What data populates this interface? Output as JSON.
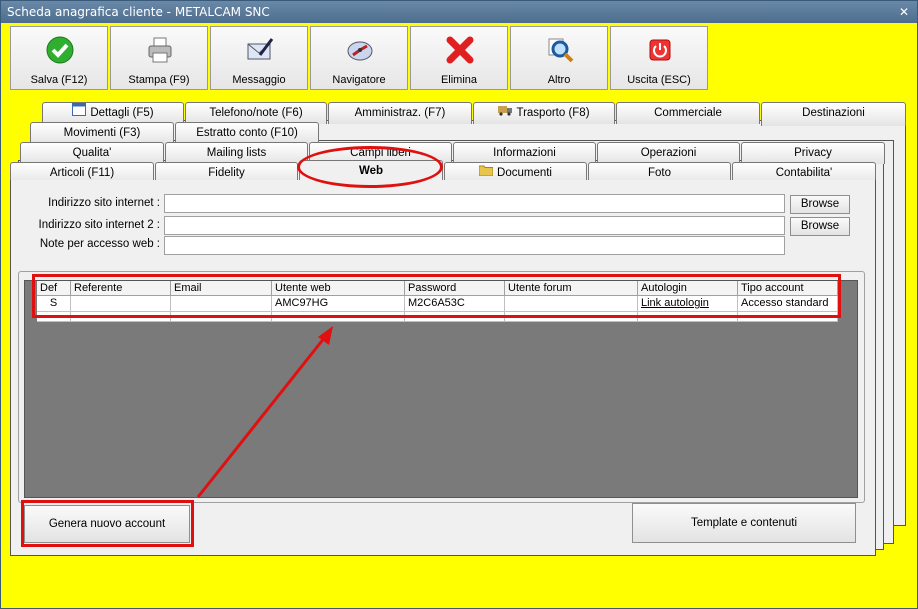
{
  "window": {
    "title": "Scheda anagrafica cliente - METALCAM SNC",
    "close_glyph": "✕"
  },
  "toolbar": [
    {
      "label": "Salva (F12)",
      "icon": "check-icon"
    },
    {
      "label": "Stampa (F9)",
      "icon": "printer-icon"
    },
    {
      "label": "Messaggio",
      "icon": "envelope-pen-icon"
    },
    {
      "label": "Navigatore",
      "icon": "compass-icon"
    },
    {
      "label": "Elimina",
      "icon": "delete-x-icon"
    },
    {
      "label": "Altro",
      "icon": "magnifier-icon"
    },
    {
      "label": "Uscita (ESC)",
      "icon": "power-icon"
    }
  ],
  "tabs": {
    "row1": [
      "Dettagli (F5)",
      "Telefono/note (F6)",
      "Amministraz. (F7)",
      "Trasporto (F8)",
      "Commerciale",
      "Destinazioni"
    ],
    "row2": [
      "Movimenti (F3)",
      "Estratto conto (F10)"
    ],
    "row3": [
      "Qualita'",
      "Mailing lists",
      "Campi liberi",
      "Informazioni",
      "Operazioni",
      "Privacy"
    ],
    "row4": [
      "Articoli (F11)",
      "Fidelity",
      "Web",
      "Documenti",
      "Foto",
      "Contabilita'"
    ],
    "active": "Web"
  },
  "form": {
    "site_label": "Indirizzo sito internet :",
    "site_value": "",
    "site2_label": "Indirizzo sito internet 2 :",
    "site2_value": "",
    "notes_label": "Note per accesso web :",
    "notes_value": "",
    "browse_label": "Browse"
  },
  "grid": {
    "columns": [
      "Def",
      "Referente",
      "Email",
      "Utente web",
      "Password",
      "Utente forum",
      "Autologin",
      "Tipo account"
    ],
    "rows": [
      [
        "S",
        "",
        "",
        "AMC97HG",
        "M2C6A53C",
        "",
        "Link autologin",
        "Accesso standard"
      ],
      [
        "",
        "",
        "",
        "",
        "",
        "",
        "",
        ""
      ]
    ]
  },
  "buttons": {
    "new_account": "Genera nuovo account",
    "templates": "Template e contenuti"
  },
  "annotation_color": "#e01010",
  "background_color": "#ffff00"
}
